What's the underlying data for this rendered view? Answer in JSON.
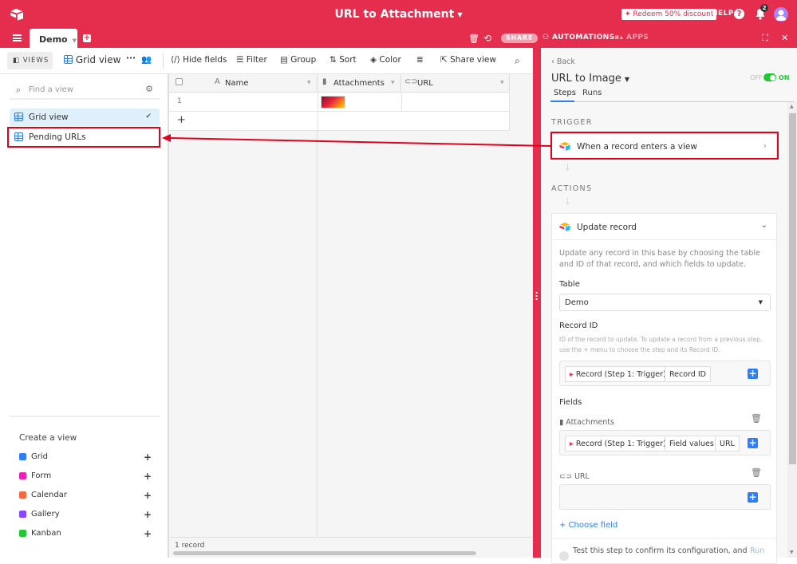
{
  "topbar": {
    "title": "URL to Attachment",
    "redeem_label": "Redeem 50% discount",
    "help_label": "HELP",
    "help_icon": "?",
    "notification_count": "2",
    "tabs": [
      {
        "label": "Demo",
        "active": true
      }
    ],
    "share_label": "SHARE",
    "automations_label": "AUTOMATIONS",
    "apps_label": "APPS",
    "brand_color": "#e52e4d"
  },
  "viewbar": {
    "views_label": "VIEWS",
    "current_view": "Grid view",
    "more": "···",
    "hide_fields": "Hide fields",
    "filter": "Filter",
    "group": "Group",
    "sort": "Sort",
    "color": "Color",
    "share_view": "Share view"
  },
  "sidebar": {
    "search_placeholder": "Find a view",
    "views": [
      {
        "label": "Grid view",
        "active": true
      },
      {
        "label": "Pending URLs",
        "active": false,
        "highlighted": true
      }
    ],
    "create_title": "Create a view",
    "create_items": [
      {
        "label": "Grid",
        "color": "#2d7ff9"
      },
      {
        "label": "Form",
        "color": "#ed1fb5"
      },
      {
        "label": "Calendar",
        "color": "#f36b3f"
      },
      {
        "label": "Gallery",
        "color": "#8b46ff"
      },
      {
        "label": "Kanban",
        "color": "#20c933"
      }
    ]
  },
  "grid": {
    "columns": [
      {
        "label": "Name",
        "type": "text"
      },
      {
        "label": "Attachments",
        "type": "attachment"
      },
      {
        "label": "URL",
        "type": "url"
      }
    ],
    "rows": [
      {
        "num": "1",
        "name": "",
        "attachments": "image-thumbnail",
        "url": ""
      }
    ],
    "add_row": "+",
    "record_count": "1 record"
  },
  "automation": {
    "back_label": "Back",
    "name": "URL to Image",
    "toggle_off": "OFF",
    "toggle_on": "ON",
    "enabled": true,
    "tabs": [
      {
        "label": "Steps",
        "active": true
      },
      {
        "label": "Runs",
        "active": false
      }
    ],
    "trigger_heading": "TRIGGER",
    "trigger_label": "When a record enters a view",
    "actions_heading": "ACTIONS",
    "action": {
      "title": "Update record",
      "description": "Update any record in this base by choosing the table and ID of that record, and which fields to update.",
      "table_label": "Table",
      "table_value": "Demo",
      "record_id_label": "Record ID",
      "record_id_desc": "ID of the record to update. To update a record from a previous step, use the + menu to choose the step and its Record ID.",
      "record_id_tokens": [
        "Record (Step 1: Trigger)",
        "Record ID"
      ],
      "fields_label": "Fields",
      "fields": [
        {
          "name": "Attachments",
          "tokens": [
            "Record (Step 1: Trigger)",
            "Field values",
            "URL"
          ]
        },
        {
          "name": "URL",
          "tokens": []
        }
      ],
      "choose_field": "+ Choose field",
      "test_text": "Test this step to confirm its configuration, and",
      "run_label": "Run"
    }
  }
}
